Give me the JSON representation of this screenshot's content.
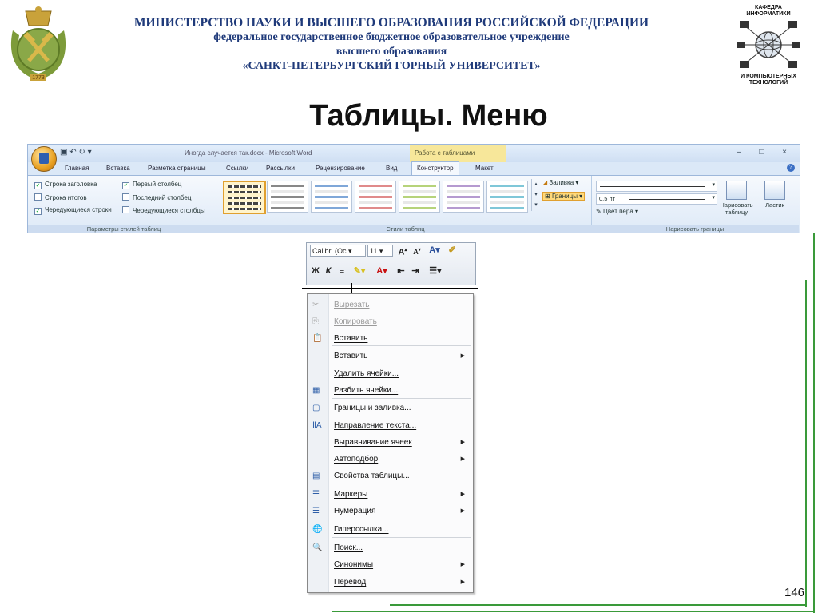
{
  "header": {
    "ministry": "МИНИСТЕРСТВО НАУКИ И ВЫСШЕГО ОБРАЗОВАНИЯ РОССИЙСКОЙ ФЕДЕРАЦИИ",
    "institution_type": "федеральное государственное бюджетное образовательное учреждение",
    "education_level": "высшего образования",
    "university": "«САНКТ-ПЕТЕРБУРГСКИЙ ГОРНЫЙ УНИВЕРСИТЕТ»",
    "dept_top": "КАФЕДРА\nИНФОРМАТИКИ",
    "dept_bottom": "И КОМПЬЮТЕРНЫХ\nТЕХНОЛОГИЙ",
    "logo_year": "1773"
  },
  "slide": {
    "title": "Таблицы. Меню",
    "page_number": "146"
  },
  "word": {
    "window_title": "Иногда случается так.docx - Microsoft Word",
    "context_tab": "Работа с таблицами",
    "window_controls": "– □ ×",
    "tabs": [
      "Главная",
      "Вставка",
      "Разметка страницы",
      "Ссылки",
      "Рассылки",
      "Рецензирование",
      "Вид",
      "Конструктор",
      "Макет"
    ],
    "style_options": {
      "header_row": "Строка заголовка",
      "total_row": "Строка итогов",
      "banded_rows": "Чередующиеся строки",
      "first_column": "Первый столбец",
      "last_column": "Последний столбец",
      "banded_columns": "Чередующиеся столбцы",
      "group_label": "Параметры стилей таблиц"
    },
    "table_styles_label": "Стили таблиц",
    "shading": "Заливка",
    "borders": "Границы",
    "pen_weight": "0,5 пт",
    "pen_color": "Цвет пера",
    "draw_table": "Нарисовать таблицу",
    "eraser": "Ластик",
    "draw_borders_label": "Нарисовать границы",
    "swatch_colors": [
      "#555555",
      "#888888",
      "#7fa7d8",
      "#e08a8a",
      "#b6d37a",
      "#b59ad0",
      "#7fc7d8",
      "#f2b36a"
    ]
  },
  "mini_toolbar": {
    "font": "Calibri (Oc",
    "size": "11",
    "bold": "Ж",
    "italic": "К"
  },
  "context_menu": {
    "items": [
      {
        "label": "Вырезать",
        "disabled": true,
        "submenu": false
      },
      {
        "label": "Копировать",
        "disabled": true,
        "submenu": false
      },
      {
        "label": "Вставить",
        "disabled": false,
        "submenu": false
      },
      {
        "label": "Вставить",
        "disabled": false,
        "submenu": true
      },
      {
        "label": "Удалить ячейки...",
        "disabled": false,
        "submenu": false
      },
      {
        "label": "Разбить ячейки...",
        "disabled": false,
        "submenu": false
      },
      {
        "label": "Границы и заливка...",
        "disabled": false,
        "submenu": false
      },
      {
        "label": "Направление текста...",
        "disabled": false,
        "submenu": false
      },
      {
        "label": "Выравнивание ячеек",
        "disabled": false,
        "submenu": true
      },
      {
        "label": "Автоподбор",
        "disabled": false,
        "submenu": true
      },
      {
        "label": "Свойства таблицы...",
        "disabled": false,
        "submenu": false
      },
      {
        "label": "Маркеры",
        "disabled": false,
        "submenu": true
      },
      {
        "label": "Нумерация",
        "disabled": false,
        "submenu": true
      },
      {
        "label": "Гиперссылка...",
        "disabled": false,
        "submenu": false
      },
      {
        "label": "Поиск...",
        "disabled": false,
        "submenu": false
      },
      {
        "label": "Синонимы",
        "disabled": false,
        "submenu": true
      },
      {
        "label": "Перевод",
        "disabled": false,
        "submenu": true
      }
    ]
  }
}
